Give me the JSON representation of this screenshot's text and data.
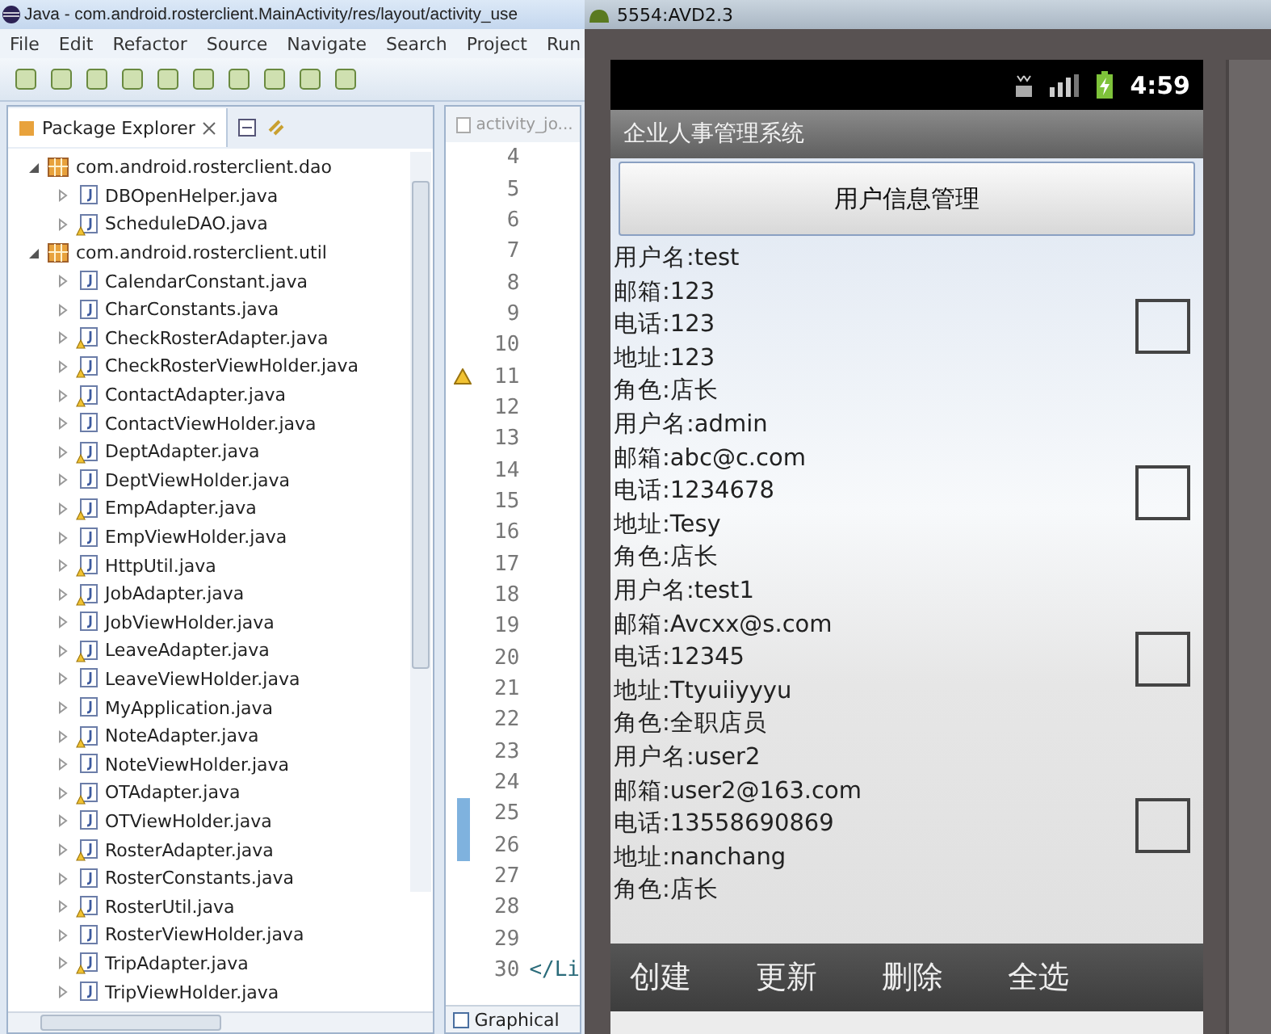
{
  "eclipse": {
    "title": "Java - com.android.rosterclient.MainActivity/res/layout/activity_use",
    "menu": [
      "File",
      "Edit",
      "Refactor",
      "Source",
      "Navigate",
      "Search",
      "Project",
      "Run"
    ],
    "explorer": {
      "tab": {
        "label": "Package Explorer",
        "selected": true
      },
      "tree": [
        {
          "label": "com.android.rosterclient.dao",
          "expanded": true,
          "children": [
            {
              "label": "DBOpenHelper.java",
              "expanded": false,
              "warning": false
            },
            {
              "label": "ScheduleDAO.java",
              "expanded": false,
              "warning": true
            }
          ]
        },
        {
          "label": "com.android.rosterclient.util",
          "expanded": true,
          "children": [
            {
              "label": "CalendarConstant.java",
              "expanded": false,
              "warning": false
            },
            {
              "label": "CharConstants.java",
              "expanded": false,
              "warning": false
            },
            {
              "label": "CheckRosterAdapter.java",
              "expanded": false,
              "warning": true
            },
            {
              "label": "CheckRosterViewHolder.java",
              "expanded": false,
              "warning": true
            },
            {
              "label": "ContactAdapter.java",
              "expanded": false,
              "warning": true
            },
            {
              "label": "ContactViewHolder.java",
              "expanded": false,
              "warning": false
            },
            {
              "label": "DeptAdapter.java",
              "expanded": false,
              "warning": true
            },
            {
              "label": "DeptViewHolder.java",
              "expanded": false,
              "warning": false
            },
            {
              "label": "EmpAdapter.java",
              "expanded": false,
              "warning": true
            },
            {
              "label": "EmpViewHolder.java",
              "expanded": false,
              "warning": false
            },
            {
              "label": "HttpUtil.java",
              "expanded": false,
              "warning": true
            },
            {
              "label": "JobAdapter.java",
              "expanded": false,
              "warning": true
            },
            {
              "label": "JobViewHolder.java",
              "expanded": false,
              "warning": false
            },
            {
              "label": "LeaveAdapter.java",
              "expanded": false,
              "warning": true
            },
            {
              "label": "LeaveViewHolder.java",
              "expanded": false,
              "warning": false
            },
            {
              "label": "MyApplication.java",
              "expanded": false,
              "warning": false
            },
            {
              "label": "NoteAdapter.java",
              "expanded": false,
              "warning": true
            },
            {
              "label": "NoteViewHolder.java",
              "expanded": false,
              "warning": false
            },
            {
              "label": "OTAdapter.java",
              "expanded": false,
              "warning": true
            },
            {
              "label": "OTViewHolder.java",
              "expanded": false,
              "warning": false
            },
            {
              "label": "RosterAdapter.java",
              "expanded": false,
              "warning": true
            },
            {
              "label": "RosterConstants.java",
              "expanded": false,
              "warning": false
            },
            {
              "label": "RosterUtil.java",
              "expanded": false,
              "warning": true
            },
            {
              "label": "RosterViewHolder.java",
              "expanded": false,
              "warning": false
            },
            {
              "label": "TripAdapter.java",
              "expanded": false,
              "warning": true
            },
            {
              "label": "TripViewHolder.java",
              "expanded": false,
              "warning": false
            }
          ]
        }
      ]
    },
    "editor": {
      "tab": {
        "label": "activity_jo...",
        "selected": false
      },
      "lines": [
        {
          "number": "4",
          "warning": false,
          "marked": false
        },
        {
          "number": "5",
          "warning": false,
          "marked": false
        },
        {
          "number": "6",
          "warning": false,
          "marked": false
        },
        {
          "number": "7",
          "warning": false,
          "marked": false
        },
        {
          "number": "8",
          "warning": false,
          "marked": false
        },
        {
          "number": "9",
          "warning": false,
          "marked": false
        },
        {
          "number": "10",
          "warning": false,
          "marked": false
        },
        {
          "number": "11",
          "warning": true,
          "marked": false
        },
        {
          "number": "12",
          "warning": false,
          "marked": false
        },
        {
          "number": "13",
          "warning": false,
          "marked": false
        },
        {
          "number": "14",
          "warning": false,
          "marked": false
        },
        {
          "number": "15",
          "warning": false,
          "marked": false
        },
        {
          "number": "16",
          "warning": false,
          "marked": false
        },
        {
          "number": "17",
          "warning": false,
          "marked": false
        },
        {
          "number": "18",
          "warning": false,
          "marked": false
        },
        {
          "number": "19",
          "warning": false,
          "marked": false
        },
        {
          "number": "20",
          "warning": false,
          "marked": false
        },
        {
          "number": "21",
          "warning": false,
          "marked": false
        },
        {
          "number": "22",
          "warning": false,
          "marked": false
        },
        {
          "number": "23",
          "warning": false,
          "marked": false
        },
        {
          "number": "24",
          "warning": false,
          "marked": false
        },
        {
          "number": "25",
          "warning": false,
          "marked": true
        },
        {
          "number": "26",
          "warning": false,
          "marked": true
        },
        {
          "number": "27",
          "warning": false,
          "marked": false
        },
        {
          "number": "28",
          "warning": false,
          "marked": false
        },
        {
          "number": "29",
          "warning": false,
          "marked": false
        },
        {
          "number": "30",
          "warning": false,
          "marked": false,
          "code": "</Li"
        }
      ],
      "bottom_tab": "Graphical"
    }
  },
  "emulator": {
    "title": "5554:AVD2.3",
    "time": "4:59",
    "app_title": "企业人事管理系统",
    "header_button": "用户信息管理",
    "users": [
      {
        "lines": [
          "用户名:test",
          "邮箱:123",
          "电话:123",
          "地址:123",
          "角色:店长"
        ],
        "checked": false
      },
      {
        "lines": [
          "用户名:admin",
          "邮箱:abc@c.com",
          "电话:1234678",
          "地址:Tesy",
          "角色:店长"
        ],
        "checked": false
      },
      {
        "lines": [
          "用户名:test1",
          "邮箱:Avcxx@s.com",
          "电话:12345",
          "地址:Ttyuiiyyyu",
          "角色:全职店员"
        ],
        "checked": false
      },
      {
        "lines": [
          "用户名:user2",
          "邮箱:user2@163.com",
          "电话:13558690869",
          "地址:nanchang",
          "角色:店长"
        ],
        "checked": false
      }
    ],
    "actions": [
      "创建",
      "更新",
      "删除",
      "全选"
    ]
  }
}
